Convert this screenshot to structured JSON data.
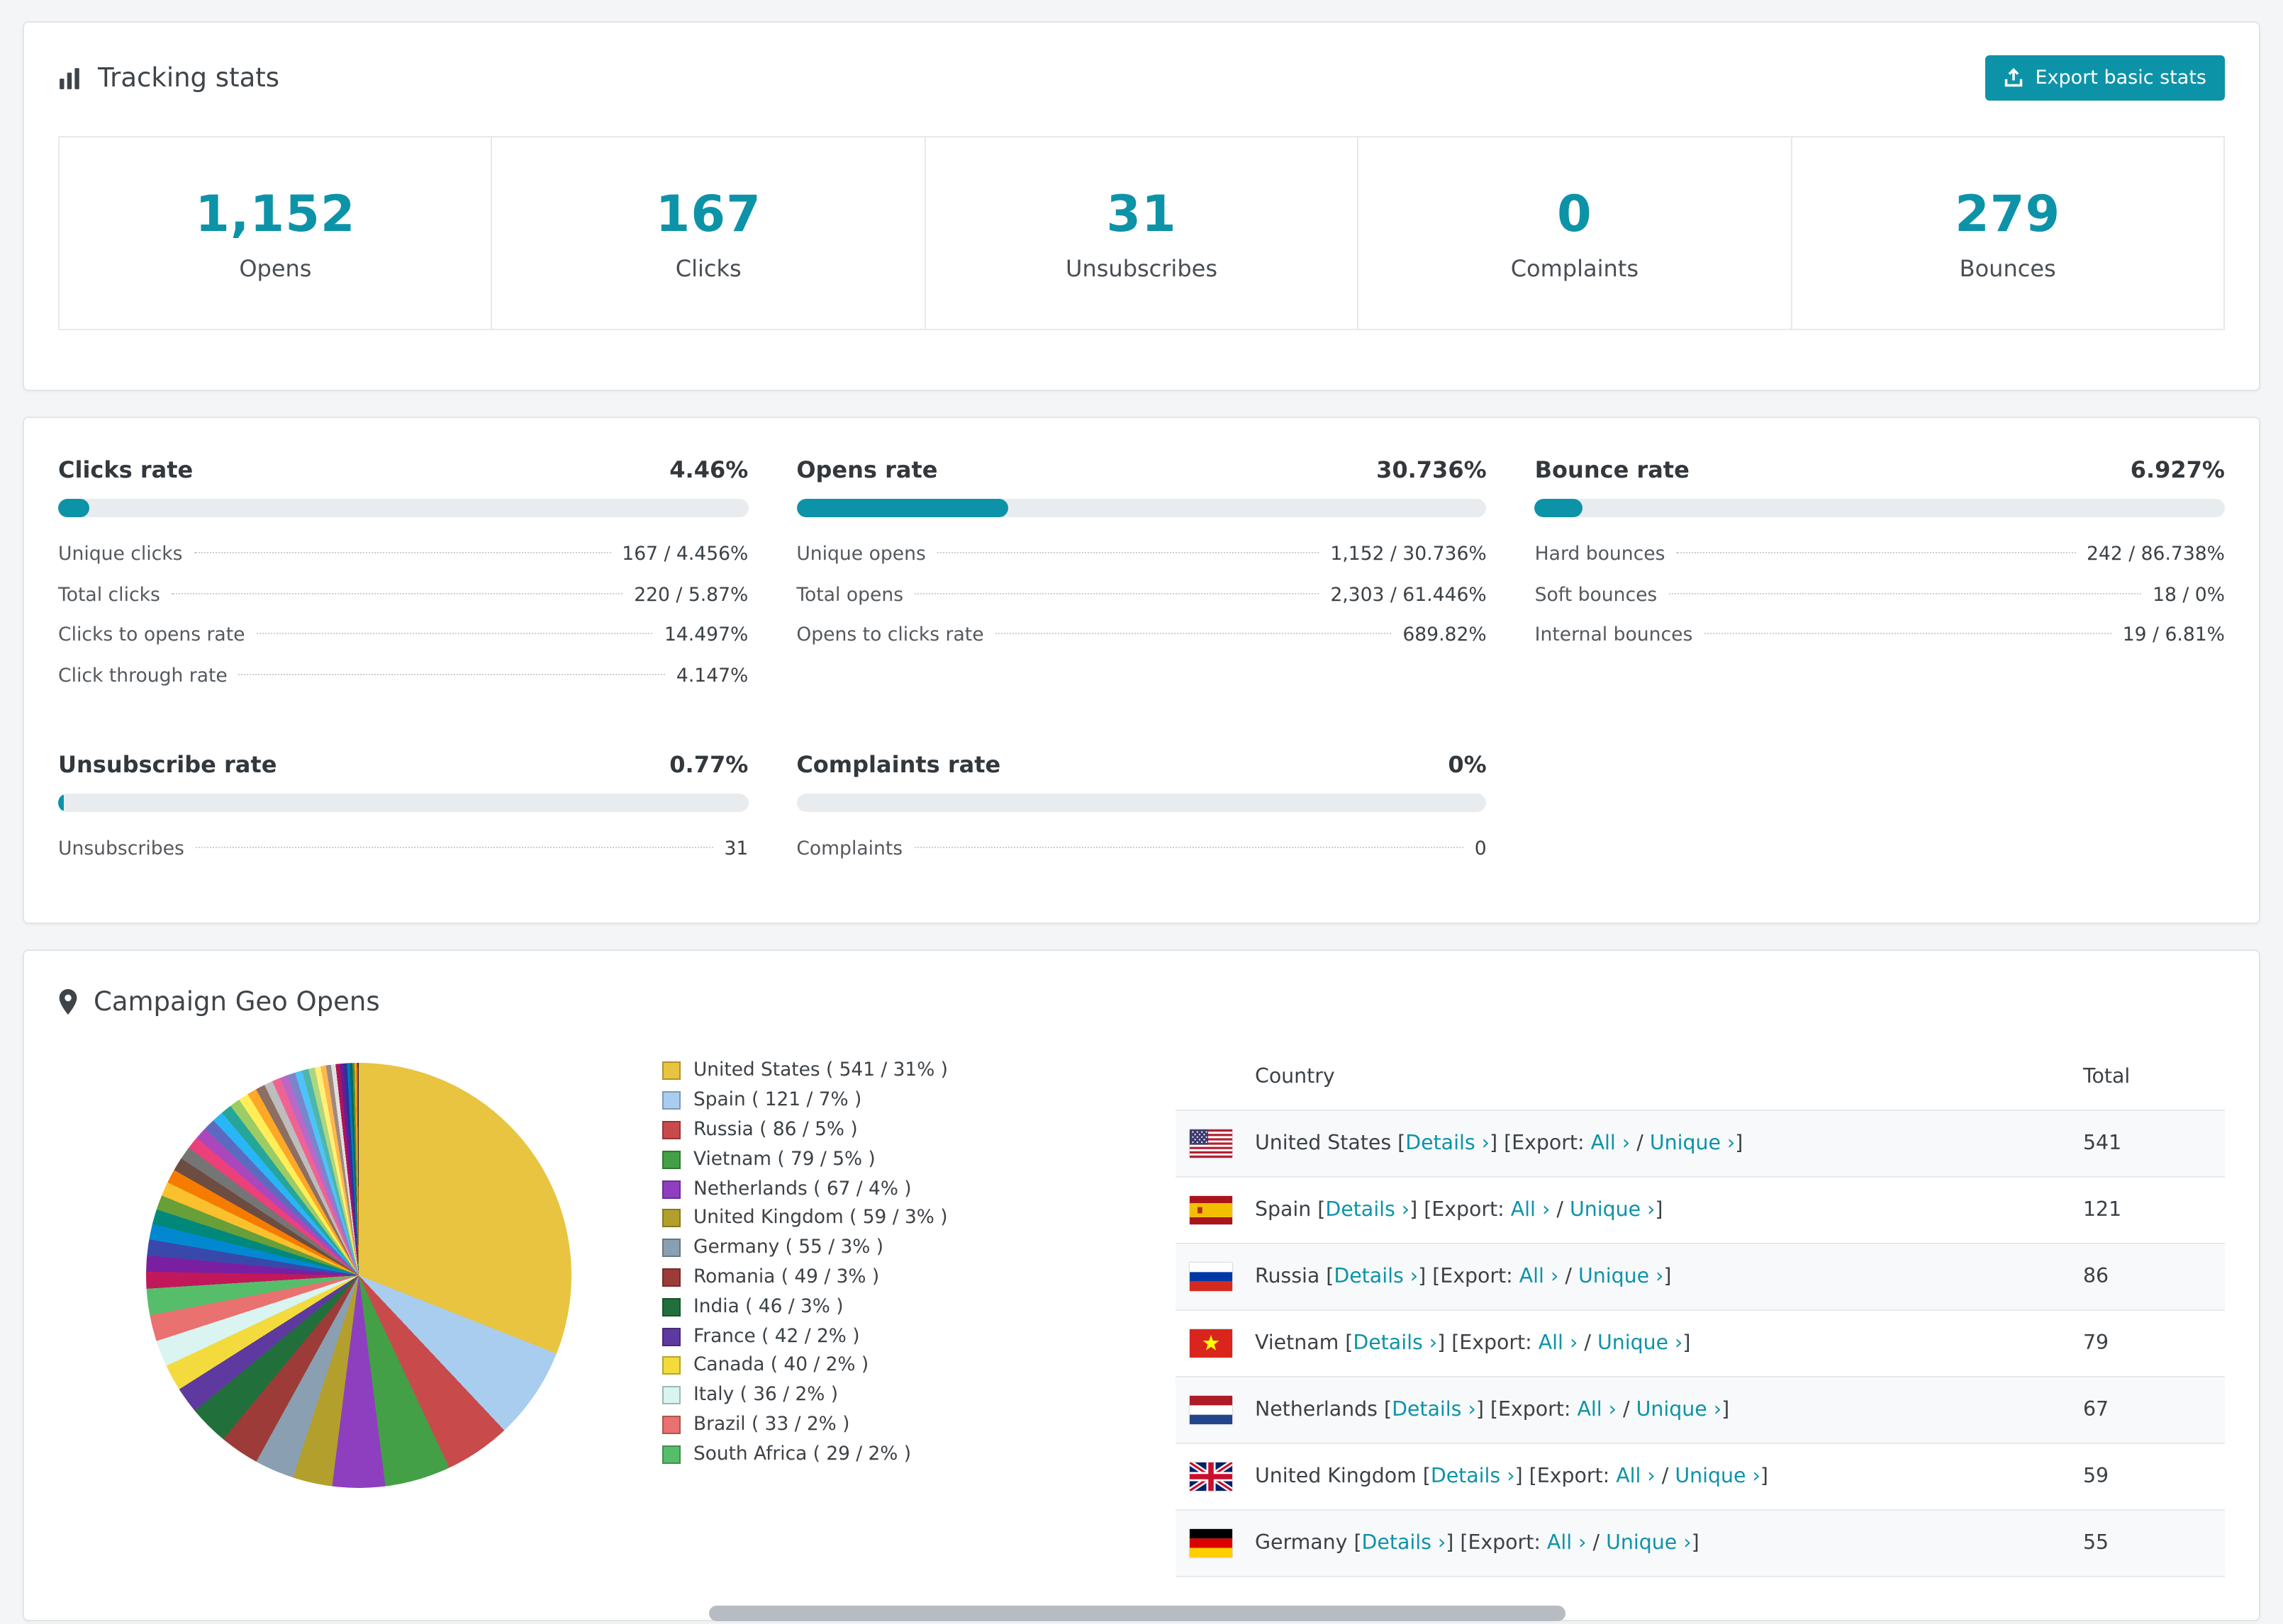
{
  "theme": {
    "accent": "#0d93a8"
  },
  "tracking": {
    "title": "Tracking stats",
    "export_button": "Export basic stats",
    "stats": [
      {
        "value": "1,152",
        "label": "Opens"
      },
      {
        "value": "167",
        "label": "Clicks"
      },
      {
        "value": "31",
        "label": "Unsubscribes"
      },
      {
        "value": "0",
        "label": "Complaints"
      },
      {
        "value": "279",
        "label": "Bounces"
      }
    ]
  },
  "rates": {
    "panels": [
      {
        "title": "Clicks rate",
        "value": "4.46%",
        "percent": 4.46,
        "rows": [
          {
            "label": "Unique clicks",
            "value": "167 / 4.456%"
          },
          {
            "label": "Total clicks",
            "value": "220 / 5.87%"
          },
          {
            "label": "Clicks to opens rate",
            "value": "14.497%"
          },
          {
            "label": "Click through rate",
            "value": "4.147%"
          }
        ]
      },
      {
        "title": "Opens rate",
        "value": "30.736%",
        "percent": 30.736,
        "rows": [
          {
            "label": "Unique opens",
            "value": "1,152 / 30.736%"
          },
          {
            "label": "Total opens",
            "value": "2,303 / 61.446%"
          },
          {
            "label": "Opens to clicks rate",
            "value": "689.82%"
          }
        ]
      },
      {
        "title": "Bounce rate",
        "value": "6.927%",
        "percent": 6.927,
        "rows": [
          {
            "label": "Hard bounces",
            "value": "242 / 86.738%"
          },
          {
            "label": "Soft bounces",
            "value": "18 / 0%"
          },
          {
            "label": "Internal bounces",
            "value": "19 / 6.81%"
          }
        ]
      },
      {
        "title": "Unsubscribe rate",
        "value": "0.77%",
        "percent": 0.77,
        "rows": [
          {
            "label": "Unsubscribes",
            "value": "31"
          }
        ]
      },
      {
        "title": "Complaints rate",
        "value": "0%",
        "percent": 0,
        "rows": [
          {
            "label": "Complaints",
            "value": "0"
          }
        ]
      }
    ]
  },
  "geo": {
    "title": "Campaign Geo Opens",
    "table": {
      "headers": [
        "Country",
        "Total"
      ],
      "link_labels": {
        "details": "Details ›",
        "export": "Export:",
        "all": "All ›",
        "unique": "Unique ›"
      },
      "rows": [
        {
          "country": "United States",
          "flag": "us",
          "total": "541"
        },
        {
          "country": "Spain",
          "flag": "es",
          "total": "121"
        },
        {
          "country": "Russia",
          "flag": "ru",
          "total": "86"
        },
        {
          "country": "Vietnam",
          "flag": "vn",
          "total": "79"
        },
        {
          "country": "Netherlands",
          "flag": "nl",
          "total": "67"
        },
        {
          "country": "United Kingdom",
          "flag": "gb",
          "total": "59"
        },
        {
          "country": "Germany",
          "flag": "de",
          "total": "55"
        }
      ]
    },
    "chart_data": {
      "type": "pie",
      "title": "Campaign Geo Opens",
      "legend_position": "right",
      "slices": [
        {
          "label": "United States",
          "value": 541,
          "pct": 31,
          "color": "#E8C440"
        },
        {
          "label": "Spain",
          "value": 121,
          "pct": 7,
          "color": "#A9CDEE"
        },
        {
          "label": "Russia",
          "value": 86,
          "pct": 5,
          "color": "#C94A4B"
        },
        {
          "label": "Vietnam",
          "value": 79,
          "pct": 5,
          "color": "#43A047"
        },
        {
          "label": "Netherlands",
          "value": 67,
          "pct": 4,
          "color": "#8E3FBF"
        },
        {
          "label": "United Kingdom",
          "value": 59,
          "pct": 3,
          "color": "#B3A02C"
        },
        {
          "label": "Germany",
          "value": 55,
          "pct": 3,
          "color": "#8A9FB1"
        },
        {
          "label": "Romania",
          "value": 49,
          "pct": 3,
          "color": "#9C3B38"
        },
        {
          "label": "India",
          "value": 46,
          "pct": 3,
          "color": "#21703B"
        },
        {
          "label": "France",
          "value": 42,
          "pct": 2,
          "color": "#5E3AA0"
        },
        {
          "label": "Canada",
          "value": 40,
          "pct": 2,
          "color": "#F3DB3D"
        },
        {
          "label": "Italy",
          "value": 36,
          "pct": 2,
          "color": "#D9F4F1"
        },
        {
          "label": "Brazil",
          "value": 33,
          "pct": 2,
          "color": "#E97170"
        },
        {
          "label": "South Africa",
          "value": 29,
          "pct": 2,
          "color": "#56BE6B"
        }
      ],
      "others": {
        "total_pct": 26,
        "palette": [
          "#C2185B",
          "#7B1FA2",
          "#3949AB",
          "#0288D1",
          "#00897B",
          "#689F38",
          "#FBC02D",
          "#F57C00",
          "#6D4C41",
          "#757575",
          "#EC407A",
          "#AB47BC",
          "#5C6BC0",
          "#29B6F6",
          "#26A69A",
          "#9CCC65",
          "#FFEE58",
          "#FFA726",
          "#8D6E63",
          "#BDBDBD",
          "#F06292",
          "#BA68C8",
          "#7986CB",
          "#4FC3F7",
          "#4DB6AC",
          "#AED581",
          "#FFF176",
          "#FFB74D",
          "#A1887F",
          "#E0E0E0",
          "#AD1457",
          "#6A1B9A",
          "#283593",
          "#0277BD",
          "#00695C",
          "#558B2F",
          "#F9A825",
          "#EF6C00",
          "#4E342E",
          "#212121"
        ]
      }
    }
  }
}
